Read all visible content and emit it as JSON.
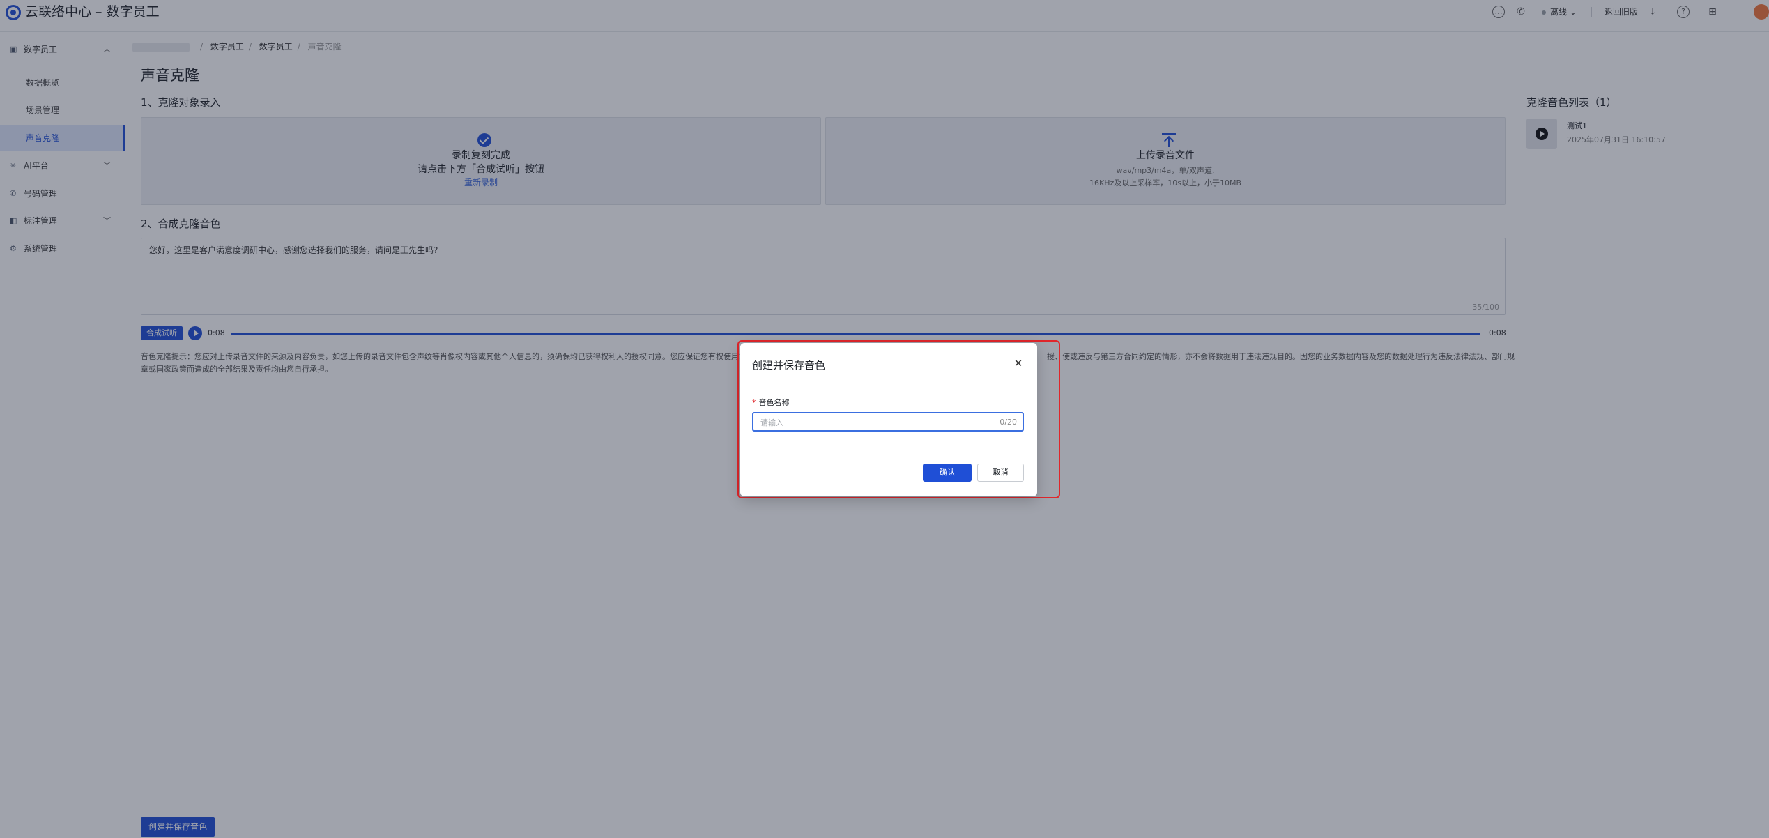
{
  "app": {
    "title": "云联络中心 – 数字员工"
  },
  "header": {
    "status_label": "离线",
    "back_link": "返回旧版",
    "icons": [
      "chat-icon",
      "phone-icon",
      "chevron-down-icon",
      "download-icon",
      "help-icon",
      "apps-icon"
    ]
  },
  "sidebar": {
    "groups": [
      {
        "label": "数字员工",
        "icon": "robot-icon",
        "expanded": true
      },
      {
        "label": "AI平台",
        "icon": "ai-icon",
        "expanded": false
      },
      {
        "label": "号码管理",
        "icon": "phone-icon"
      },
      {
        "label": "标注管理",
        "icon": "tag-icon",
        "expanded": false
      },
      {
        "label": "系统管理",
        "icon": "settings-icon"
      }
    ],
    "sub_items": [
      "数据概览",
      "场景管理",
      "声音克隆"
    ],
    "active_item": "声音克隆"
  },
  "breadcrumb": [
    "数字员工",
    "数字员工",
    "声音克隆"
  ],
  "page": {
    "title": "声音克隆",
    "section1": "1、克隆对象录入",
    "section2": "2、合成克隆音色",
    "record_card": {
      "line1": "录制复刻完成",
      "line2": "请点击下方「合成试听」按钮",
      "rerecord": "重新录制"
    },
    "upload_card": {
      "title": "上传录音文件",
      "hint1": "wav/mp3/m4a，单/双声道,",
      "hint2": "16KHz及以上采样率，10s以上，小于10MB"
    },
    "script_text": "您好，这里是客户满意度调研中心，感谢您选择我们的服务，请问是王先生吗?",
    "char_count": "35/100",
    "synth_button": "合成试听",
    "time_start": "0:08",
    "time_end": "0:08",
    "progress_percent": 100,
    "notice_line1": "音色克隆提示：您应对上传录音文件的来源及内容负责，如您上传的录音文件包含声纹等肖像权内容或其他个人信息的，须确保均已获得权利人的授权同意。您应保证您有权使用本",
    "notice_line1_end": "授、使或违反与第三方合同约定的情形，亦不会将数据用于违法违规目的。因您的业务数据内容及您的数据处理行为违反法律法规、部门规",
    "notice_line2": "章或国家政策而造成的全部结果及责任均由您自行承担。",
    "save_button": "创建并保存音色"
  },
  "voice_list": {
    "title": "克隆音色列表（1）",
    "items": [
      {
        "name": "测试1",
        "date": "2025年07月31日 16:10:57"
      }
    ]
  },
  "modal": {
    "title": "创建并保存音色",
    "field_label": "音色名称",
    "placeholder": "请输入",
    "counter": "0/20",
    "confirm": "确认",
    "cancel": "取消"
  }
}
